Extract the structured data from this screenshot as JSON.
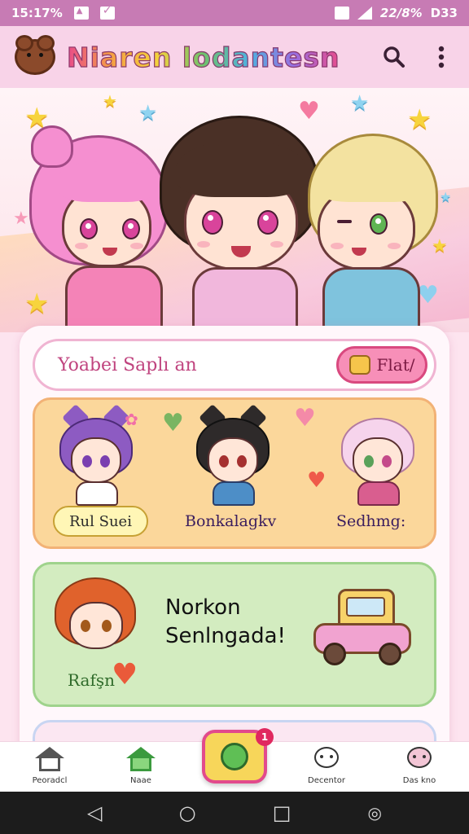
{
  "status_bar": {
    "time": "15:17%",
    "battery_text": "22/8%",
    "extra": "D33"
  },
  "header": {
    "title": "Niaren lodantesn",
    "search_icon": "search-icon",
    "menu_icon": "more-vert-icon"
  },
  "search": {
    "placeholder": "Yoabei Saplı an",
    "button_label": "Flat/"
  },
  "panel_yellow": {
    "labels": [
      "Rul Suei",
      "Bonkalagkv",
      "Sedhmg:"
    ]
  },
  "panel_green": {
    "title_line1": "Norkon",
    "title_line2": "Senlngada!",
    "tag": "Rafşn"
  },
  "bottom_nav": {
    "items": [
      "Peoradcl",
      "Naae",
      "Decentor",
      "Das kno"
    ],
    "badge_count": "1"
  },
  "colors": {
    "accent_pink": "#e24a8c",
    "header_bg": "#f8d3e8",
    "status_bar": "#c77bb4"
  }
}
